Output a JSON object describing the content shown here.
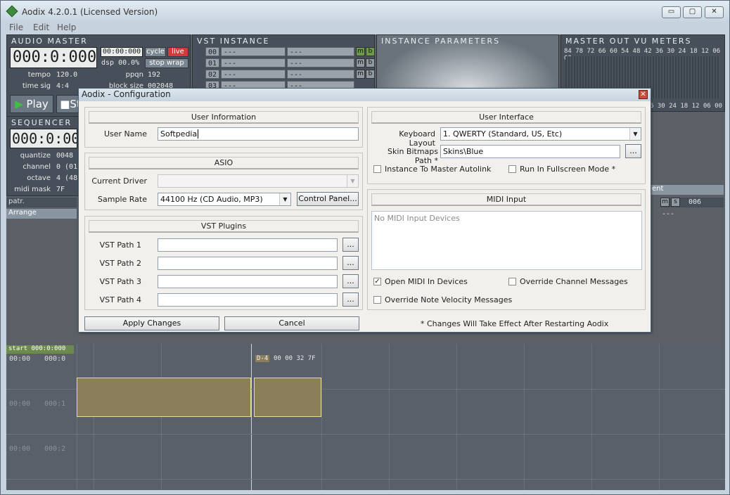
{
  "window": {
    "title": "Aodix 4.2.0.1 (Licensed Version)",
    "min": "▭",
    "max": "▢",
    "close": "✕"
  },
  "menu": [
    "File",
    "Edit",
    "Help"
  ],
  "audio_master": {
    "title": "AUDIO MASTER",
    "time": "000:0:000",
    "pos": "00:00:000",
    "cycle": "cycle",
    "live": "live",
    "dsp": "dsp 00.0%",
    "stop_wrap": "stop wrap",
    "tempo_lbl": "tempo",
    "tempo": "120.0",
    "ppqn_lbl": "ppqn",
    "ppqn": "192",
    "timesig_lbl": "time sig",
    "timesig": "4:4",
    "block_lbl": "block size",
    "block": "002048",
    "play": "Play",
    "stop": "St"
  },
  "vst_instance": {
    "title": "VST INSTANCE",
    "rows": [
      {
        "n": "00",
        "a": "---",
        "b": "---"
      },
      {
        "n": "01",
        "a": "---",
        "b": "---"
      },
      {
        "n": "02",
        "a": "---",
        "b": "---"
      },
      {
        "n": "03",
        "a": "---",
        "b": "---"
      }
    ],
    "m": "m",
    "b": "b"
  },
  "instance_params": {
    "title": "INSTANCE PARAMETERS"
  },
  "vu": {
    "title": "MASTER OUT VU METERS",
    "scale": "84 78 72 66 60 54 48 42 36 30 24 18 12 06 00",
    "scale2": "6 30 24 18 12 06 00"
  },
  "sequencer": {
    "title": "SEQUENCER E",
    "time": "000:0:000",
    "quantize_lbl": "quantize",
    "quantize": "0048",
    "channel_lbl": "channel",
    "channel": "0 (01",
    "octave_lbl": "octave",
    "octave": "4 (48",
    "midimask_lbl": "midi mask",
    "midimask": "7F",
    "patr": "patr.",
    "arrange": "Arrange",
    "ent": "ent",
    "num": "006",
    "dash": "---"
  },
  "timeline": {
    "start": "start",
    "start_pos": "000:0:000",
    "t0": "00:00",
    "t0b": "000:0",
    "t1": "00:00",
    "t1b": "000:1",
    "t2": "00:00",
    "t2b": "000:2",
    "note": "D-4",
    "note_vals": "00 00 32 7F"
  },
  "dialog": {
    "title": "Aodix - Configuration",
    "close": "✕",
    "user_info": {
      "head": "User Information",
      "username_lbl": "User Name",
      "username": "Softpedia"
    },
    "asio": {
      "head": "ASIO",
      "driver_lbl": "Current Driver",
      "driver": "",
      "rate_lbl": "Sample Rate",
      "rate": "44100 Hz (CD Audio, MP3)",
      "control_panel": "Control Panel..."
    },
    "vst": {
      "head": "VST Plugins",
      "paths": [
        {
          "lbl": "VST Path 1",
          "val": ""
        },
        {
          "lbl": "VST Path 2",
          "val": ""
        },
        {
          "lbl": "VST Path 3",
          "val": ""
        },
        {
          "lbl": "VST Path 4",
          "val": ""
        }
      ],
      "browse": "..."
    },
    "ui": {
      "head": "User Interface",
      "kb_lbl": "Keyboard Layout",
      "kb": "1. QWERTY (Standard, US, Etc)",
      "skin_lbl": "Skin Bitmaps Path *",
      "skin": "Skins\\Blue",
      "browse": "...",
      "autolink": "Instance To Master Autolink",
      "fullscreen": "Run In Fullscreen Mode *"
    },
    "midi": {
      "head": "MIDI Input",
      "list_placeholder": "No MIDI Input Devices",
      "open_in": "Open MIDI In Devices",
      "override_ch": "Override Channel Messages",
      "override_vel": "Override Note Velocity Messages"
    },
    "apply": "Apply Changes",
    "cancel": "Cancel",
    "note": "* Changes Will Take Effect After Restarting Aodix"
  }
}
